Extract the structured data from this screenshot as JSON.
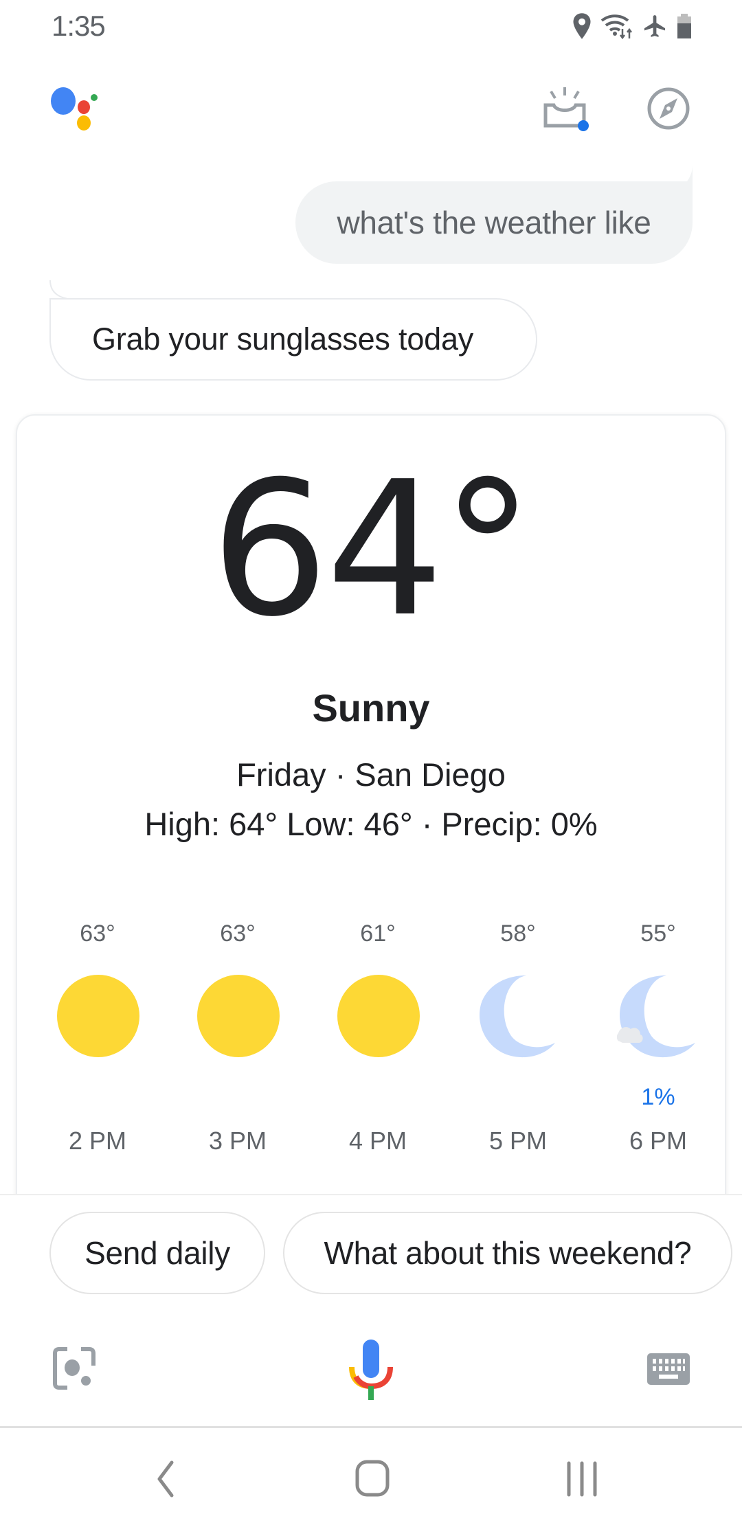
{
  "status_bar": {
    "time": "1:35",
    "icons": [
      "location-icon",
      "wifi-data-icon",
      "airplane-mode-icon",
      "battery-icon"
    ]
  },
  "header": {
    "logo": "google-assistant-logo",
    "actions": [
      {
        "name": "snapshot-icon",
        "has_notification_dot": true,
        "dot_color": "#1a73e8"
      },
      {
        "name": "explore-compass-icon"
      }
    ]
  },
  "conversation": {
    "user_query": "what's the weather like",
    "assistant_reply": "Grab your sunglasses today"
  },
  "weather": {
    "current_temp": "64°",
    "condition": "Sunny",
    "day_location": "Friday · San Diego",
    "summary": "High: 64° Low: 46° · Precip: 0%",
    "hourly": [
      {
        "temp": "63°",
        "icon": "sun",
        "precip": "",
        "time": "2 PM"
      },
      {
        "temp": "63°",
        "icon": "sun",
        "precip": "",
        "time": "3 PM"
      },
      {
        "temp": "61°",
        "icon": "sun",
        "precip": "",
        "time": "4 PM"
      },
      {
        "temp": "58°",
        "icon": "moon",
        "precip": "",
        "time": "5 PM"
      },
      {
        "temp": "55°",
        "icon": "moon-cloud",
        "precip": "1%",
        "time": "6 PM"
      }
    ]
  },
  "suggestions": [
    "Send daily",
    "What about this weekend?"
  ],
  "input_bar": {
    "left": "lens-icon",
    "center": "microphone-icon",
    "right": "keyboard-icon"
  },
  "navigation": [
    "back",
    "home",
    "recents"
  ],
  "colors": {
    "sun": "#fdd835",
    "moon": "#c6dafc",
    "precip_text": "#1a73e8",
    "google_blue": "#4285f4",
    "google_red": "#ea4335",
    "google_yellow": "#fbbc04",
    "google_green": "#34a853"
  }
}
